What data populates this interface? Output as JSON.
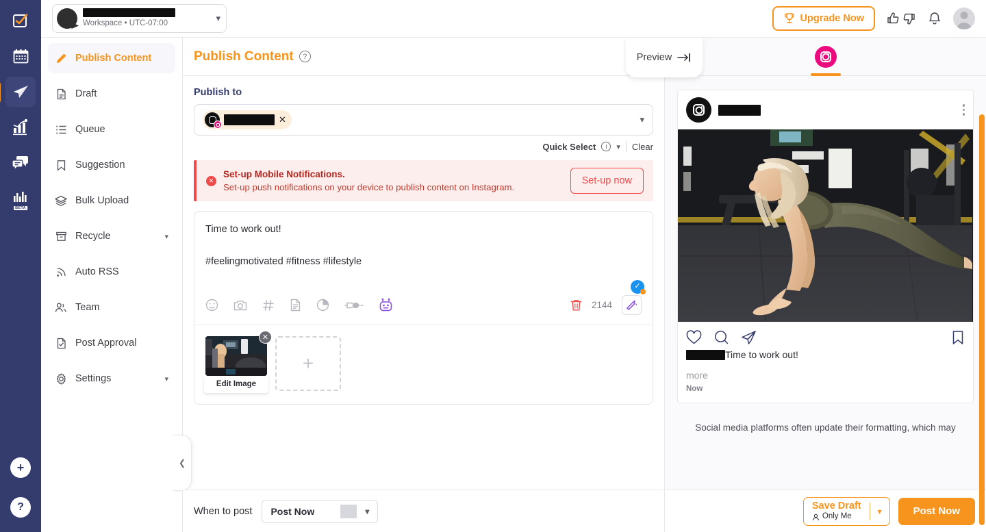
{
  "rail": {
    "items": [
      {
        "name": "tasks-icon",
        "label": "Tasks"
      },
      {
        "name": "calendar-icon",
        "label": "Calendar"
      },
      {
        "name": "publish-icon",
        "label": "Publish"
      },
      {
        "name": "analytics-icon",
        "label": "Analytics"
      },
      {
        "name": "engage-icon",
        "label": "Engage"
      },
      {
        "name": "reports-icon",
        "label": "Reports",
        "badge": "BETA"
      }
    ],
    "bottom": [
      {
        "name": "add-icon",
        "label": "+"
      },
      {
        "name": "help-icon",
        "label": "?"
      }
    ]
  },
  "topbar": {
    "workspace": {
      "name_redacted": "",
      "subtitle": "Workspace • UTC-07:00"
    },
    "upgrade_label": "Upgrade Now",
    "icons": [
      "trophy-icon",
      "thumbs-up-icon",
      "thumbs-down-icon",
      "bell-icon",
      "avatar"
    ]
  },
  "sidebar": {
    "items": [
      {
        "label": "Publish Content",
        "icon": "pencil-icon",
        "active": true,
        "expandable": false
      },
      {
        "label": "Draft",
        "icon": "document-icon",
        "active": false,
        "expandable": false
      },
      {
        "label": "Queue",
        "icon": "list-icon",
        "active": false,
        "expandable": false
      },
      {
        "label": "Suggestion",
        "icon": "bookmark-icon",
        "active": false,
        "expandable": false
      },
      {
        "label": "Bulk Upload",
        "icon": "layers-icon",
        "active": false,
        "expandable": false
      },
      {
        "label": "Recycle",
        "icon": "archive-icon",
        "active": false,
        "expandable": true
      },
      {
        "label": "Auto RSS",
        "icon": "rss-icon",
        "active": false,
        "expandable": false
      },
      {
        "label": "Team",
        "icon": "users-icon",
        "active": false,
        "expandable": false
      },
      {
        "label": "Post Approval",
        "icon": "document-check-icon",
        "active": false,
        "expandable": false
      },
      {
        "label": "Settings",
        "icon": "gear-icon",
        "active": false,
        "expandable": true
      }
    ],
    "collapse_icon": "chevron-left-icon"
  },
  "editor": {
    "page_title": "Publish Content",
    "help_icon": "question-mark-icon",
    "preview_tab_label": "Preview",
    "preview_tab_icon": "arrow-right-to-line-icon",
    "publish_to_label": "Publish to",
    "selected_account": {
      "redacted": true,
      "platform": "instagram"
    },
    "quick_select_label": "Quick Select",
    "clear_label": "Clear",
    "alert": {
      "title": "Set-up Mobile Notifications.",
      "description": "Set-up push notifications on your device to publish content on Instagram.",
      "button_label": "Set-up now",
      "icon": "error-circle-icon"
    },
    "composer": {
      "line1": "Time to work out!",
      "line2": "#feelingmotivated #fitness #lifestyle",
      "char_count": "2144",
      "verified_icon": "verified-check-icon",
      "tools": [
        "emoji-icon",
        "camera-icon",
        "hashtag-icon",
        "document-icon",
        "chart-icon",
        "plug-icon",
        "ai-bot-icon"
      ],
      "trash_icon": "trash-icon",
      "wand_icon": "magic-wand-icon"
    },
    "media": {
      "edit_image_label": "Edit Image",
      "remove_icon": "close-icon",
      "add_icon": "plus-icon"
    },
    "when_to_post_label": "When to post",
    "when_to_post_value": "Post Now"
  },
  "preview": {
    "platform_icon": "instagram-icon",
    "card": {
      "username_redacted": true,
      "menu_icon": "more-vertical-icon",
      "actions": [
        "heart-icon",
        "comment-icon",
        "share-icon",
        "bookmark-icon"
      ],
      "caption": "Time to work out!",
      "more_label": "more",
      "timestamp": "Now"
    },
    "disclaimer": "Social media platforms often update their formatting, which may",
    "save_draft_label": "Save Draft",
    "save_draft_sub": "Only Me",
    "save_draft_sub_icon": "person-icon",
    "post_now_label": "Post Now"
  },
  "colors": {
    "rail_bg": "#343b6d",
    "accent_orange": "#f7941d",
    "instagram_pink": "#ec0b7f",
    "alert_red": "#f04a4a",
    "heading_navy": "#343b6d",
    "purple_ai": "#8b4ce0"
  }
}
